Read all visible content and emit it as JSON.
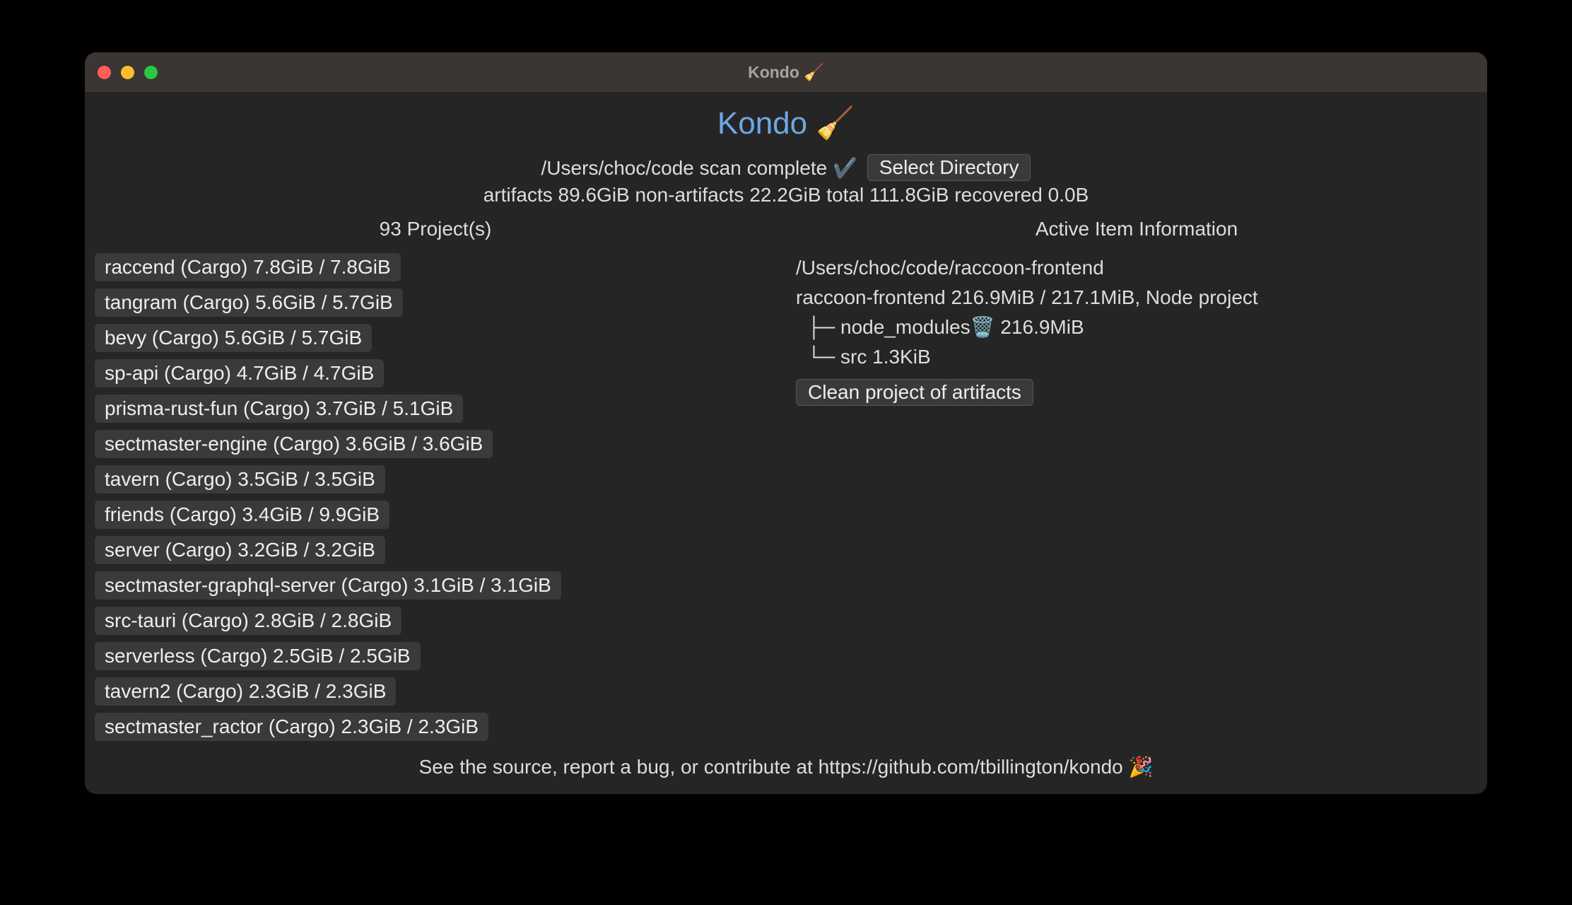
{
  "titlebar": {
    "title": "Kondo 🧹"
  },
  "header": {
    "app_title": "Kondo 🧹",
    "scan_status": "/Users/choc/code scan complete ✔️",
    "select_directory_label": "Select Directory",
    "stats": "artifacts 89.6GiB non-artifacts 22.2GiB total 111.8GiB recovered 0.0B"
  },
  "left": {
    "header": "93 Project(s)",
    "projects": [
      "raccend (Cargo) 7.8GiB / 7.8GiB",
      "tangram (Cargo) 5.6GiB / 5.7GiB",
      "bevy (Cargo) 5.6GiB / 5.7GiB",
      "sp-api (Cargo) 4.7GiB / 4.7GiB",
      "prisma-rust-fun (Cargo) 3.7GiB / 5.1GiB",
      "sectmaster-engine (Cargo) 3.6GiB / 3.6GiB",
      "tavern (Cargo) 3.5GiB / 3.5GiB",
      "friends (Cargo) 3.4GiB / 9.9GiB",
      "server (Cargo) 3.2GiB / 3.2GiB",
      "sectmaster-graphql-server (Cargo) 3.1GiB / 3.1GiB",
      "src-tauri (Cargo) 2.8GiB / 2.8GiB",
      "serverless (Cargo) 2.5GiB / 2.5GiB",
      "tavern2 (Cargo) 2.3GiB / 2.3GiB",
      "sectmaster_ractor (Cargo) 2.3GiB / 2.3GiB"
    ]
  },
  "right": {
    "header": "Active Item Information",
    "path": "/Users/choc/code/raccoon-frontend",
    "summary": "raccoon-frontend 216.9MiB / 217.1MiB, Node project",
    "tree_line1": "  ├─ node_modules🗑️ 216.9MiB",
    "tree_line2": "  └─ src 1.3KiB",
    "clean_label": "Clean project of artifacts"
  },
  "footer": {
    "text": "See the source, report a bug, or contribute at https://github.com/tbillington/kondo 🎉"
  }
}
